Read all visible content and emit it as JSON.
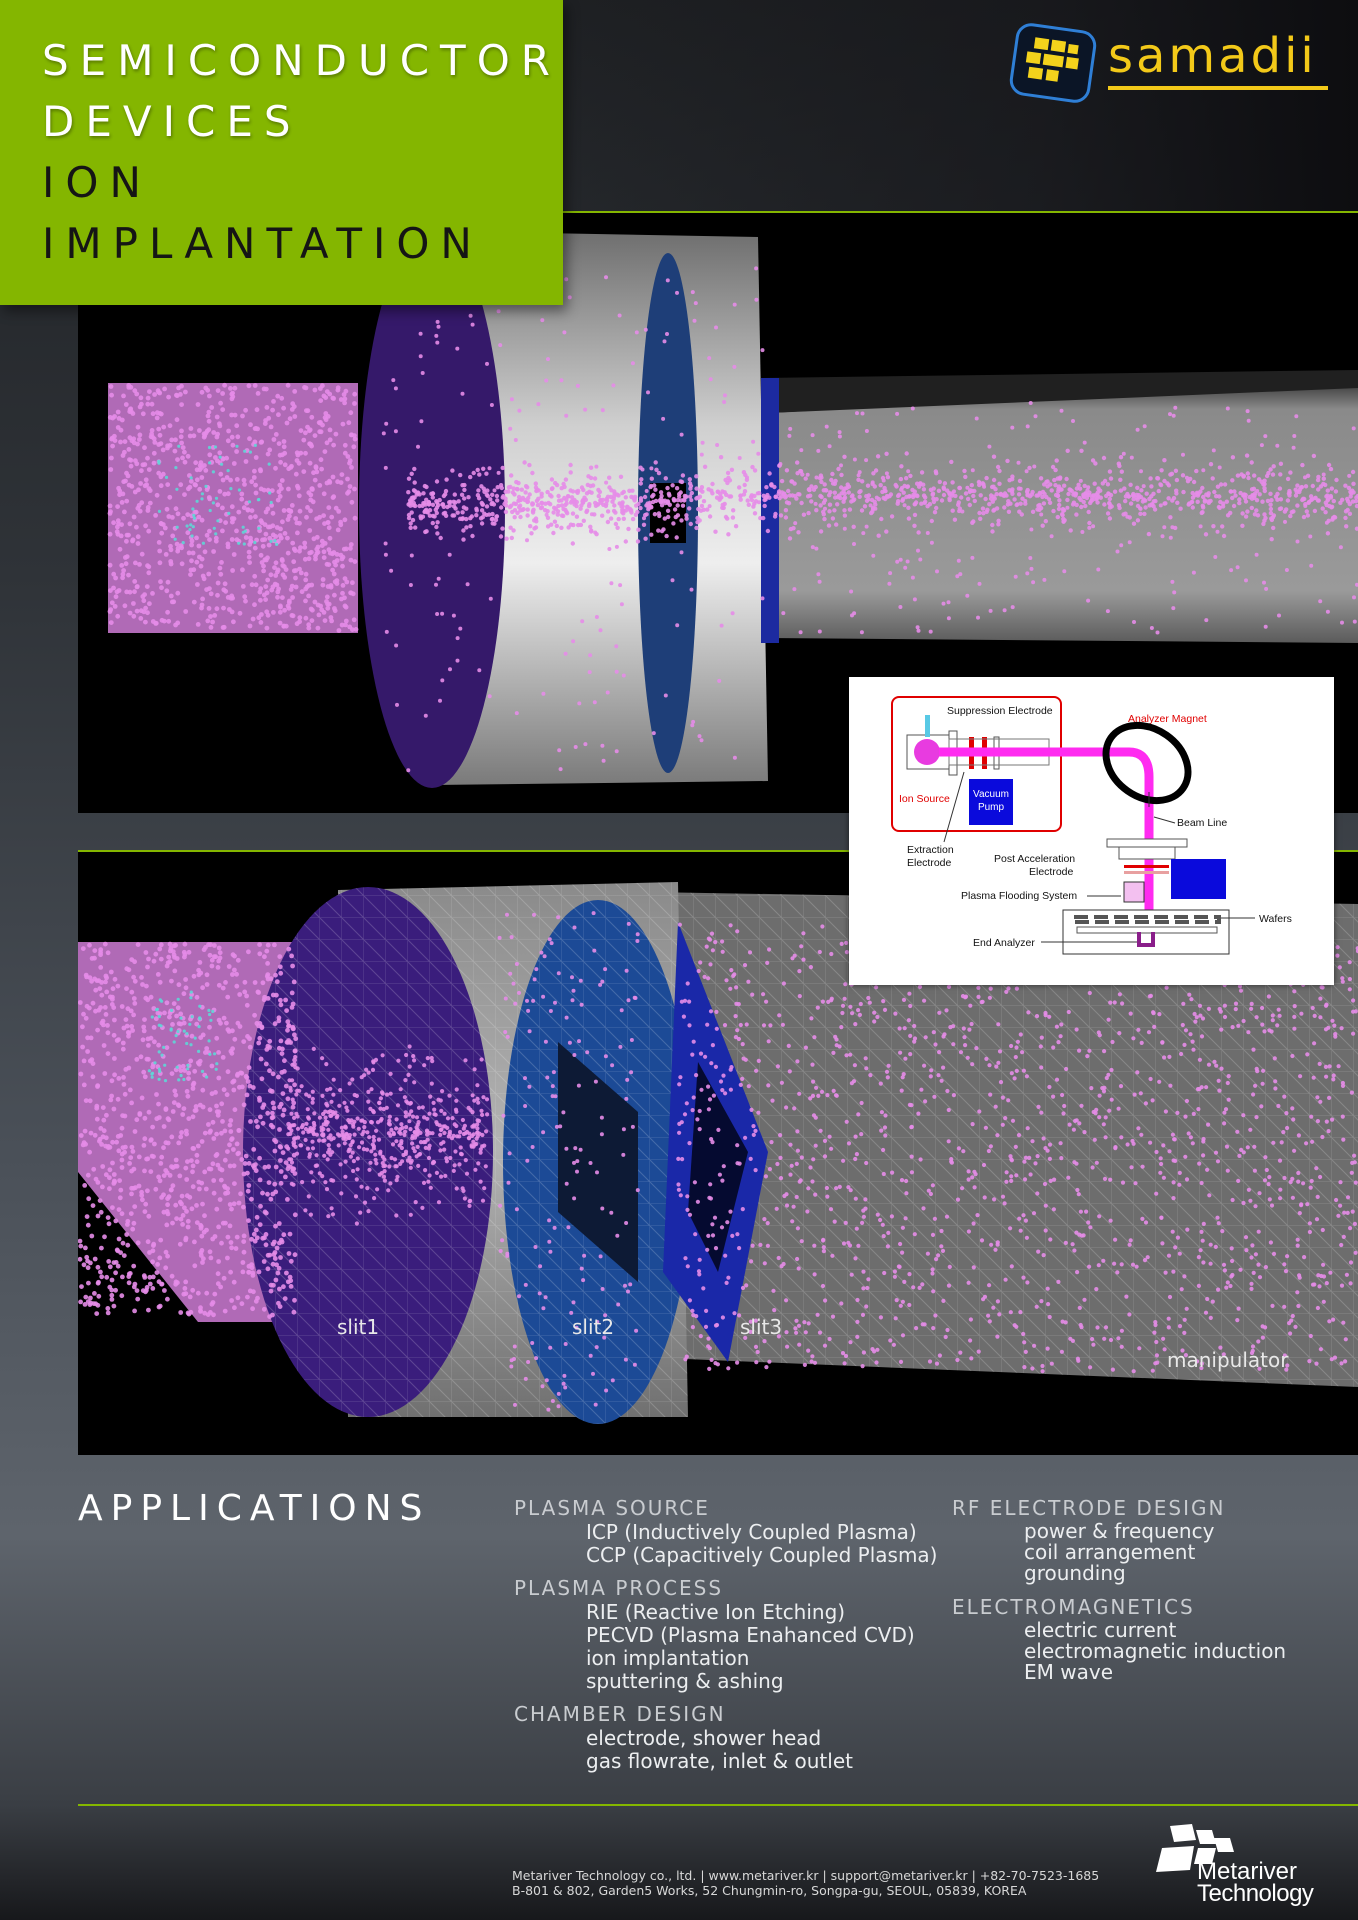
{
  "title": {
    "line1": "SEMICONDUCTOR",
    "line2": "DEVICES",
    "line3": "ION",
    "line4": "IMPLANTATION"
  },
  "logo": {
    "brand": "samadii"
  },
  "panel_bottom": {
    "labels": {
      "slit1": "slit1",
      "slit2": "slit2",
      "slit3": "slit3",
      "manipulator": "manipulator"
    }
  },
  "diagram": {
    "suppression": "Suppression Electrode",
    "analyzer": "Analyzer Magnet",
    "ion_source": "Ion Source",
    "vacuum1": "Vacuum",
    "vacuum2": "Pump",
    "beam_line": "Beam Line",
    "extraction1": "Extraction",
    "extraction2": "Electrode",
    "post_acc1": "Post Acceleration",
    "post_acc2": "Electrode",
    "plasma_flood": "Plasma Flooding System",
    "wafers": "Wafers",
    "end_analyzer": "End Analyzer"
  },
  "applications": {
    "heading": "APPLICATIONS",
    "col1": [
      {
        "head": "PLASMA SOURCE",
        "items": [
          "ICP (Inductively Coupled Plasma)",
          "CCP (Capacitively Coupled Plasma)"
        ]
      },
      {
        "head": "PLASMA PROCESS",
        "items": [
          "RIE (Reactive Ion Etching)",
          "PECVD (Plasma Enahanced CVD)",
          "ion implantation",
          "sputtering & ashing"
        ]
      },
      {
        "head": "CHAMBER DESIGN",
        "items": [
          "electrode, shower head",
          "gas flowrate, inlet & outlet"
        ]
      }
    ],
    "col2": [
      {
        "head": "RF ELECTRODE DESIGN",
        "items": [
          "power & frequency",
          "coil arrangement",
          "grounding"
        ]
      },
      {
        "head": "ELECTROMAGNETICS",
        "items": [
          "electric current",
          "electromagnetic induction",
          "EM wave"
        ]
      }
    ]
  },
  "footer": {
    "line1": "Metariver Technology co., ltd. | www.metariver.kr | support@metariver.kr | +82-70-7523-1685",
    "line2": "B-801 & 802, Garden5 Works, 52 Chungmin-ro, Songpa-gu, SEOUL, 05839, KOREA",
    "company1": "Metariver",
    "company2": "Technology"
  },
  "colors": {
    "accent": "#84b600",
    "brand_yellow": "#f3c919",
    "particle": "#e58ce8"
  }
}
